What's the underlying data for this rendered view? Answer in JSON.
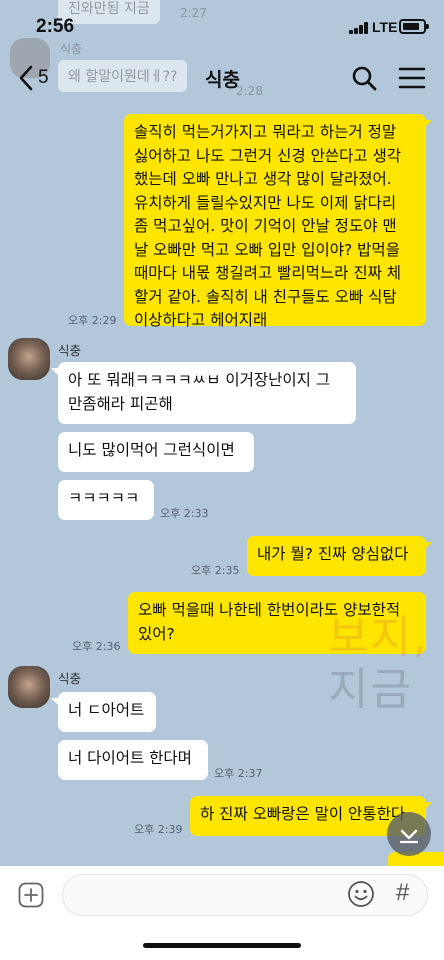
{
  "status_bar": {
    "time": "2:56",
    "network": "LTE",
    "battery_level": 0.85,
    "signal_bars": 4
  },
  "ghost": {
    "text1": "진와만됨 지금",
    "time1": "2:27",
    "sender": "식충",
    "text2": "왜 할말이뭔데ㅔ??",
    "time2": "2:28"
  },
  "header": {
    "back_count": "5",
    "title": "식충"
  },
  "messages": [
    {
      "from": "me",
      "lines": [
        "솔직히 먹는거가지고 뭐라고 하는거 정말",
        "싫어하고 나도 그런거 신경 안쓴다고 생각",
        "했는데 오빠 만나고 생각 많이 달라졌어.",
        "유치하게 들릴수있지만 나도 이제 닭다리",
        "좀 먹고싶어. 맛이 기억이 안날 정도야 맨",
        "날 오빠만 먹고 오빠 입만 입이야? 밥먹을",
        "때마다 내몫 챙길려고 빨리먹느라 진짜 체",
        "할거 같아. 솔직히 내 친구들도 오빠 식탐",
        "이상하다고 헤어지래"
      ],
      "time": "오후 2:29"
    },
    {
      "from": "them",
      "sender": "식충",
      "lines": [
        "아 또 뭐래ㅋㅋㅋㅋㅆㅂ 이거장난이지 그",
        "만좀해라 피곤해"
      ]
    },
    {
      "from": "them",
      "lines": [
        "니도 많이먹어 그런식이면"
      ]
    },
    {
      "from": "them",
      "lines": [
        "ㅋㅋㅋㅋㅋ"
      ],
      "time": "오후 2:33"
    },
    {
      "from": "me",
      "lines": [
        "내가 뭘? 진짜 양심없다"
      ],
      "time": "오후 2:35"
    },
    {
      "from": "me",
      "lines": [
        "오빠 먹을때 나한테 한번이라도 양보한적",
        "있어?"
      ],
      "time": "오후 2:36"
    },
    {
      "from": "them",
      "sender": "식충",
      "lines": [
        "너 ㄷ아어트"
      ]
    },
    {
      "from": "them",
      "lines": [
        "너 다이어트 한다며"
      ],
      "time": "오후 2:37"
    },
    {
      "from": "me",
      "lines": [
        "하 진짜 오빠랑은 말이 안통한다"
      ],
      "time": "오후 2:39"
    }
  ],
  "watermark": {
    "line1": "보지,",
    "line2": "지금"
  },
  "input": {
    "placeholder": "",
    "hash": "#"
  },
  "colors": {
    "background": "#b2c7d9",
    "my_bubble": "#fee500",
    "their_bubble": "#ffffff"
  }
}
